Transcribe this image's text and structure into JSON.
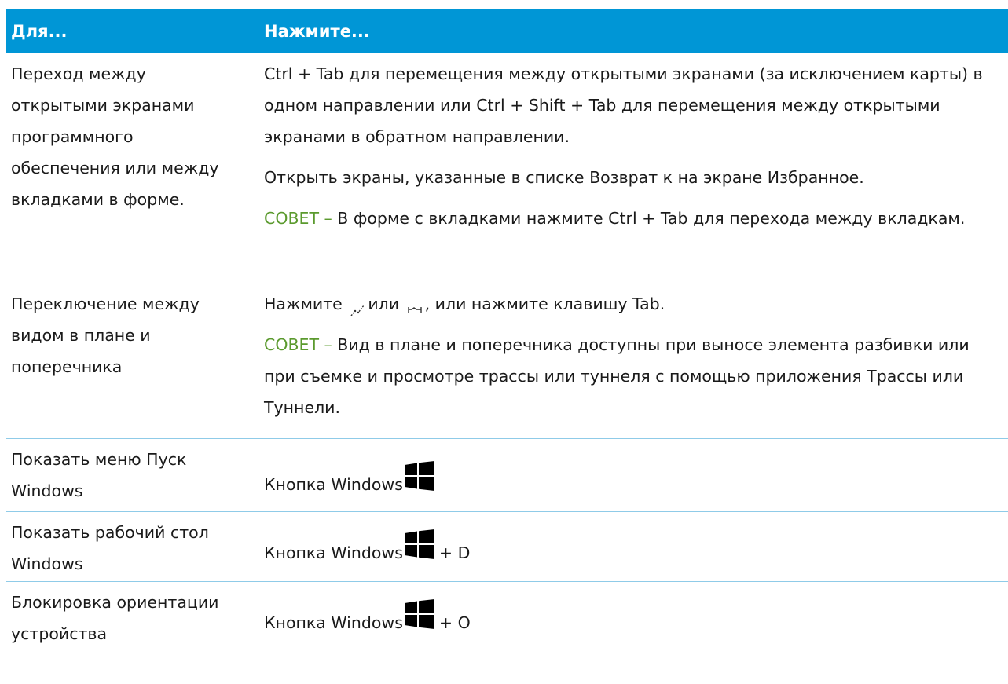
{
  "header": {
    "col1": "Для...",
    "col2": "Нажмите..."
  },
  "rows": [
    {
      "left": "Переход между открытыми экранами программного обеспечения или между вкладками в форме.",
      "p1": "Ctrl + Tab для перемещения между открытыми экранами (за исключением карты) в одном направлении или Ctrl + Shift + Tab для перемещения между открытыми экранами в обратном направлении.",
      "p2": "Открыть экраны, указанные в списке Возврат к на экране Избранное.",
      "tip_label": "СОВЕТ –",
      "tip_text": " В форме с вкладками нажмите Ctrl + Tab для перехода между вкладкам."
    },
    {
      "left": "Переключение между видом в плане и поперечника",
      "p1_a": "Нажмите",
      "p1_b": "или",
      "p1_c": ", или нажмите клавишу Tab.",
      "icons": [
        "plan-view-icon",
        "cross-section-icon"
      ],
      "tip_label": "СОВЕТ –",
      "tip_text": " Вид в плане и поперечника доступны при выносе элемента разбивки или при съемке и просмотре трассы или туннеля с помощью приложения Трассы или Туннели."
    },
    {
      "left": "Показать меню Пуск Windows",
      "text": "Кнопка Windows",
      "suffix": ""
    },
    {
      "left": "Показать рабочий стол Windows",
      "text": "Кнопка Windows",
      "suffix": " + D"
    },
    {
      "left": "Блокировка ориентации устройства",
      "text": "Кнопка Windows",
      "suffix": " + O"
    }
  ],
  "colors": {
    "header_bg": "#0096d6",
    "tip": "#5b9a2e",
    "rule": "#8fcbe8"
  }
}
